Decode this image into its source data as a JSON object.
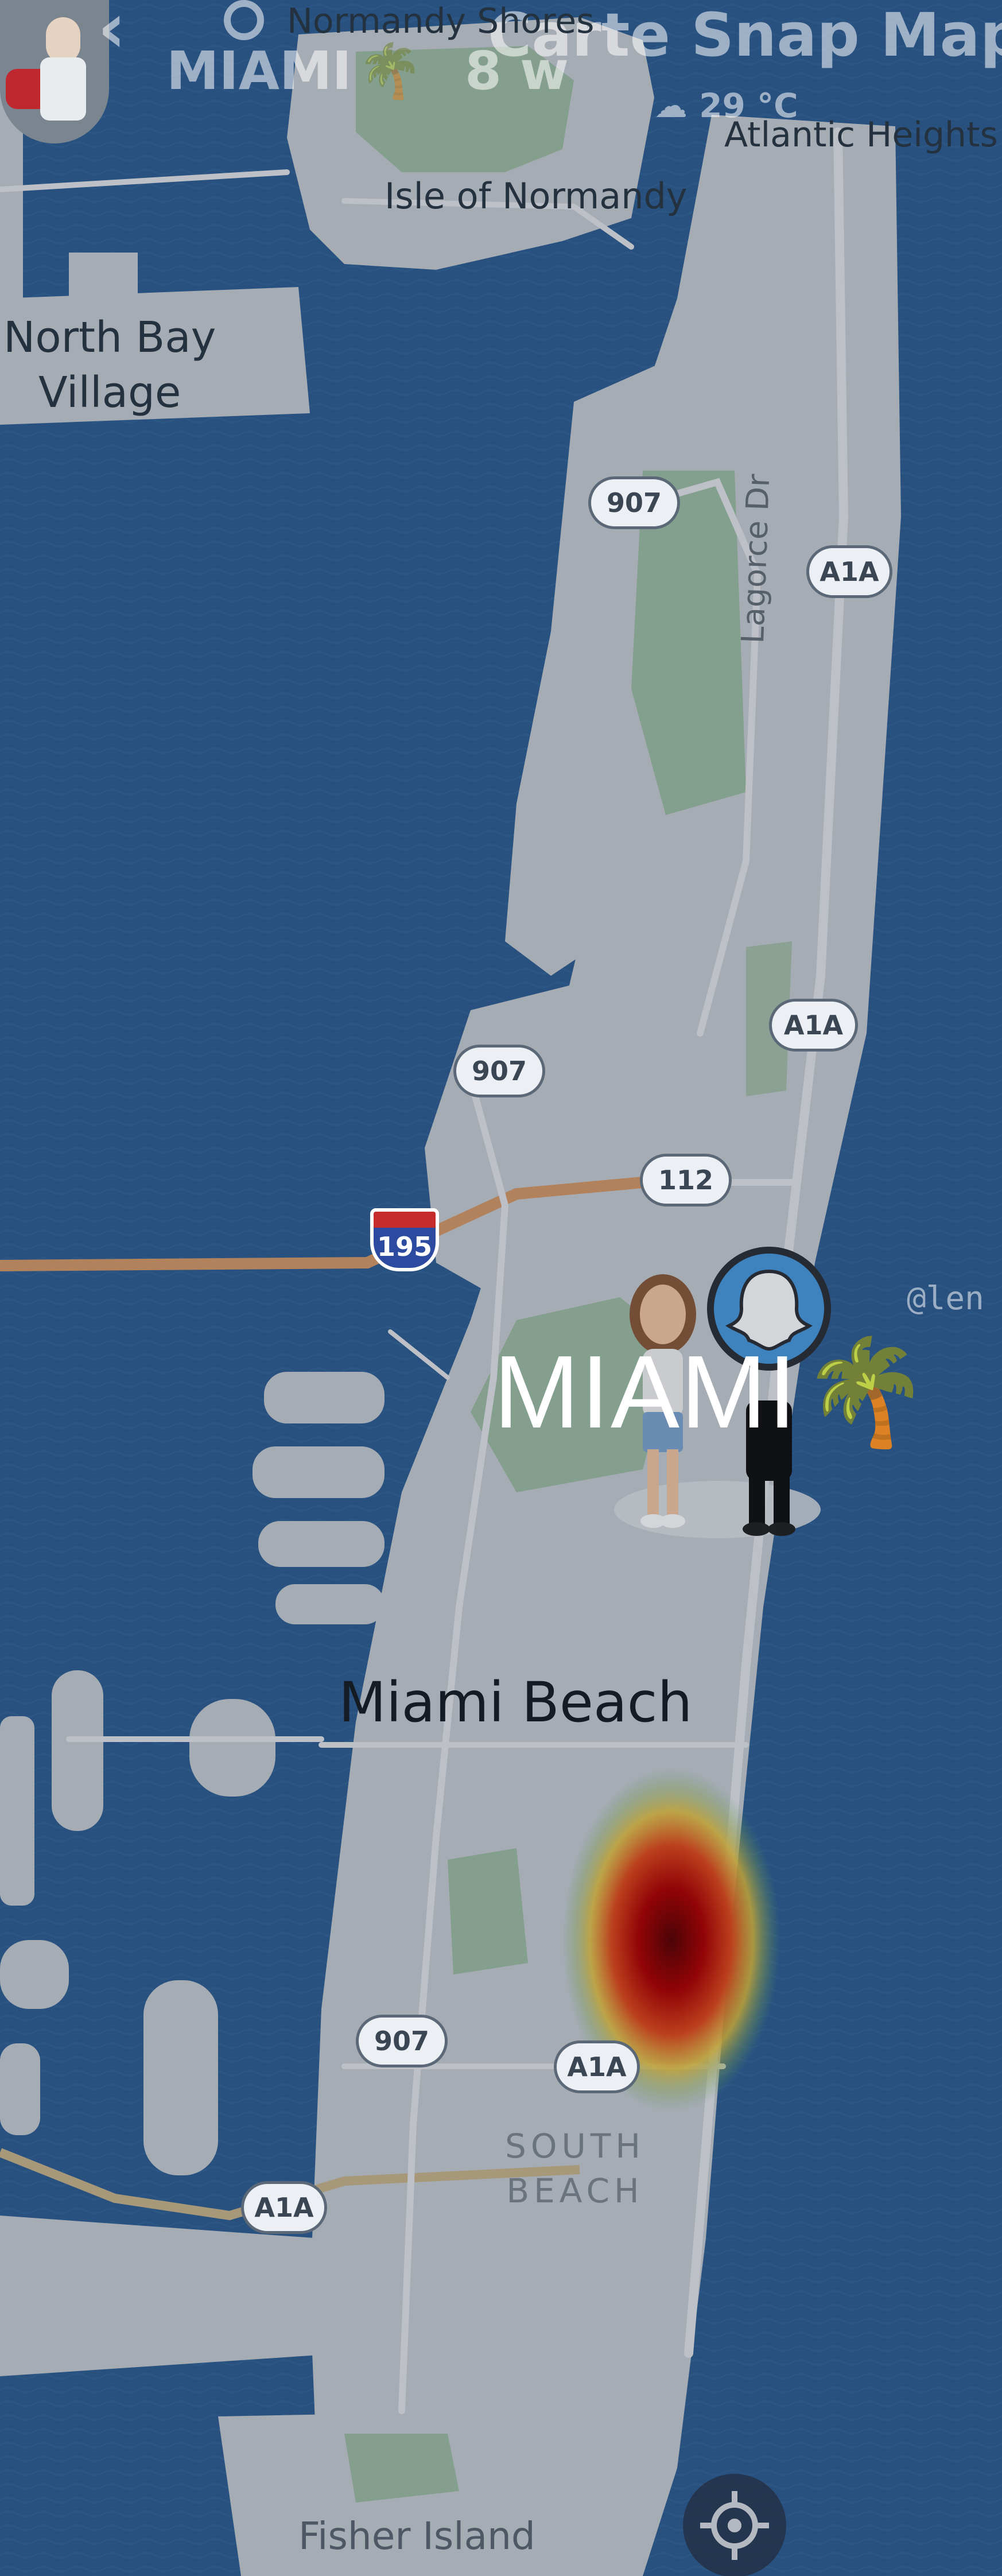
{
  "header": {
    "back_icon": "chevron-left-icon",
    "search_icon": "search-icon",
    "story_title": "MIAMI",
    "story_emoji": "🌴",
    "story_age": "8 w",
    "carte_title": "Carte Snap Map",
    "weather_icon": "cloud-icon",
    "weather_temp": "29 °C"
  },
  "places": {
    "normandy_shores": "Normandy Shores",
    "isle_of_normandy": "Isle of Normandy",
    "north_bay_village_line1": "North Bay",
    "north_bay_village_line2": "Village",
    "atlantic_heights": "Atlantic Heights",
    "lagorce_dr": "Lagorce Dr",
    "miami_beach": "Miami Beach",
    "south_beach_line1": "SOUTH",
    "south_beach_line2": "BEACH",
    "fisher_island": "Fisher Island"
  },
  "shields": {
    "r907_a": "907",
    "a1a_a": "A1A",
    "r907_b": "907",
    "a1a_b": "A1A",
    "r112": "112",
    "i195": "195",
    "r907_c": "907",
    "a1a_c": "A1A",
    "a1a_d": "A1A"
  },
  "caption": {
    "text": "MIAMI",
    "emoji": "🌴"
  },
  "handle": "@len",
  "colors": {
    "water": "#2f5f93",
    "land": "#c9cdd3",
    "park": "#8fb894",
    "road": "#e4e6ea",
    "highway": "#d79a6a",
    "heat_core": "#8b0000",
    "snap_ring": "#4a9be0"
  }
}
